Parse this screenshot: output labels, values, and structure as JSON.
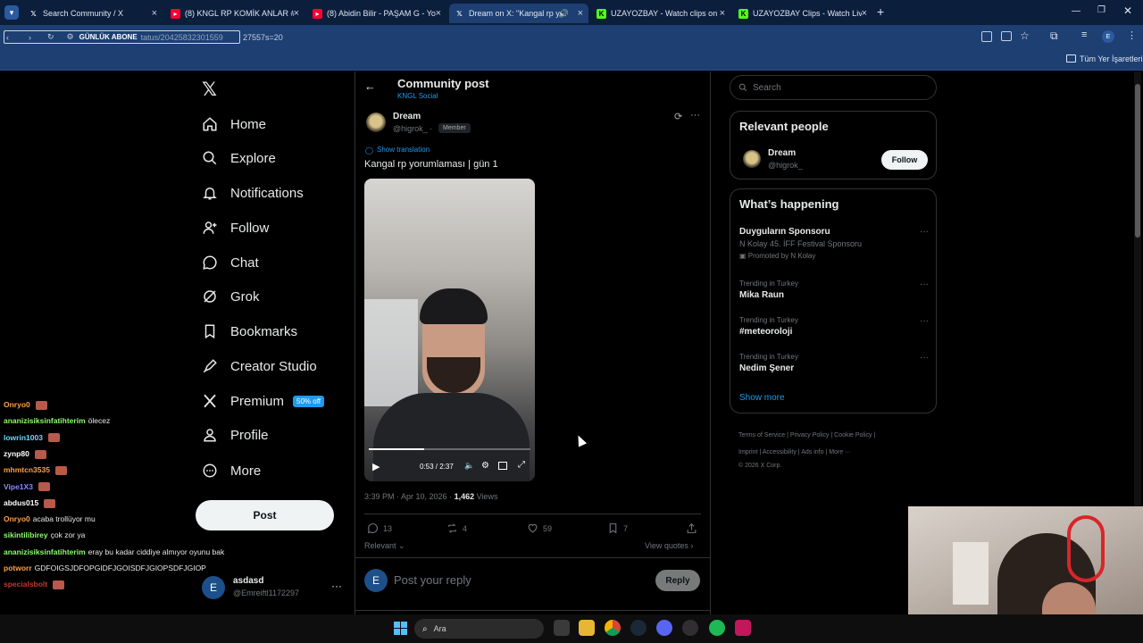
{
  "browser": {
    "tabs": [
      {
        "label": "Search Community / X",
        "icon": "x-logo-icon",
        "color": "#ffffff"
      },
      {
        "label": "(8) KNGL RP KOMİK ANLAR #9",
        "icon": "youtube-icon",
        "color": "#ff0033"
      },
      {
        "label": "(8) Abidin Bilir - PAŞAM G - You",
        "icon": "youtube-icon",
        "color": "#ff0033"
      },
      {
        "label": "Dream on X: \"Kangal rp yor",
        "icon": "x-logo-icon",
        "color": "#ffffff"
      },
      {
        "label": "UZAYOZBAY - Watch clips on K",
        "icon": "kick-icon",
        "color": "#53fc18"
      },
      {
        "label": "UZAYOZBAY Clips - Watch Live",
        "icon": "kick-icon",
        "color": "#53fc18"
      }
    ],
    "new_tab": "+",
    "address_overlay": "GÜNLÜK ABONE",
    "address_url": "tatus/20425832301559",
    "address_suffix": "27557s=20",
    "bookmarks_label": "Tüm Yer İşaretleri"
  },
  "nav": {
    "items": [
      {
        "label": "Home",
        "icon": "home-icon"
      },
      {
        "label": "Explore",
        "icon": "search-icon"
      },
      {
        "label": "Notifications",
        "icon": "bell-icon"
      },
      {
        "label": "Follow",
        "icon": "follow-icon"
      },
      {
        "label": "Chat",
        "icon": "chat-icon"
      },
      {
        "label": "Grok",
        "icon": "grok-icon"
      },
      {
        "label": "Bookmarks",
        "icon": "bookmark-icon"
      },
      {
        "label": "Creator Studio",
        "icon": "rocket-icon"
      },
      {
        "label": "Premium",
        "icon": "x-logo-icon"
      },
      {
        "label": "Profile",
        "icon": "profile-icon"
      },
      {
        "label": "More",
        "icon": "more-icon"
      }
    ],
    "premium_badge": "50% off",
    "post_label": "Post",
    "account_name": "asdasd",
    "account_handle": "@Emreiftl1172297",
    "account_avatar": "E"
  },
  "post": {
    "header_title": "Community post",
    "header_sub": "KNGL Social",
    "author_name": "Dream",
    "author_handle": "@higrok_ · ",
    "member_badge": "Member",
    "show_translation": "Show translation",
    "text": "Kangal rp yorumlaması | gün 1",
    "video_time": "0:53 / 2:37",
    "video_progress": 0.34,
    "timestamp": "3:39 PM · Apr 10, 2026 · ",
    "views_count": "1,462",
    "views_label": " Views",
    "replies": "13",
    "reposts": "4",
    "likes": "59",
    "bookmarks": "7",
    "relevant_label": "Relevant",
    "view_quotes": "View quotes",
    "reply_avatar": "E",
    "reply_placeholder": "Post your reply",
    "reply_button": "Reply"
  },
  "sidebar": {
    "search_placeholder": "Search",
    "relevant_title": "Relevant people",
    "person_name": "Dream",
    "person_handle": "@higrok_",
    "follow_label": "Follow",
    "happening_title": "What’s happening",
    "trends": [
      {
        "title": "Duyguların Sponsoru",
        "sub": "N Kolay 45. İFF Festival Sponsoru",
        "promo": "Promoted by N Kolay"
      },
      {
        "small": "Trending in Turkey",
        "title": "Mika Raun"
      },
      {
        "small": "Trending in Turkey",
        "title": "#meteoroloji"
      },
      {
        "small": "Trending in Turkey",
        "title": "Nedim Şener"
      }
    ],
    "show_more": "Show more",
    "footer": [
      "Terms of Service",
      "Privacy Policy",
      "Cookie Policy",
      "Imprint",
      "Accessibility",
      "Ads info",
      "More ···",
      "© 2026 X Corp."
    ]
  },
  "chat": [
    {
      "user": "Onryo0",
      "msg": "",
      "color": "#ff9f43",
      "emote": true
    },
    {
      "user": "ananizisiksinfatihterim",
      "msg": "ölecez",
      "color": "#8bff6a",
      "emote": false
    },
    {
      "user": "lowrin1003",
      "msg": "",
      "color": "#6ad9ff",
      "emote": true
    },
    {
      "user": "zynp80",
      "msg": "",
      "color": "#ffffff",
      "emote": true
    },
    {
      "user": "mhmtcn3535",
      "msg": "",
      "color": "#ff9f43",
      "emote": true
    },
    {
      "user": "Vipe1X3",
      "msg": "",
      "color": "#8b8bff",
      "emote": true
    },
    {
      "user": "abdus015",
      "msg": "",
      "color": "#ffffff",
      "emote": true
    },
    {
      "user": "Onryo0",
      "msg": "acaba trollüyor mu",
      "color": "#ff9f43",
      "emote": false
    },
    {
      "user": "sikintilibirey",
      "msg": "çok zor ya",
      "color": "#8bff6a",
      "emote": false
    },
    {
      "user": "ananizisiksinfatihterim",
      "msg": "eray bu kadar ciddiye almıyor oyunu bak",
      "color": "#8bff6a",
      "emote": false
    },
    {
      "user": "potworr",
      "msg": "GDFOIGSJDFOPGIDFJGOISDFJGIOPSDFJGIOP",
      "color": "#ff9f43",
      "emote": false
    },
    {
      "user": "specialsbolt",
      "msg": "",
      "color": "#c0392b",
      "emote": true
    }
  ],
  "taskbar": {
    "search_label": "Ara"
  }
}
